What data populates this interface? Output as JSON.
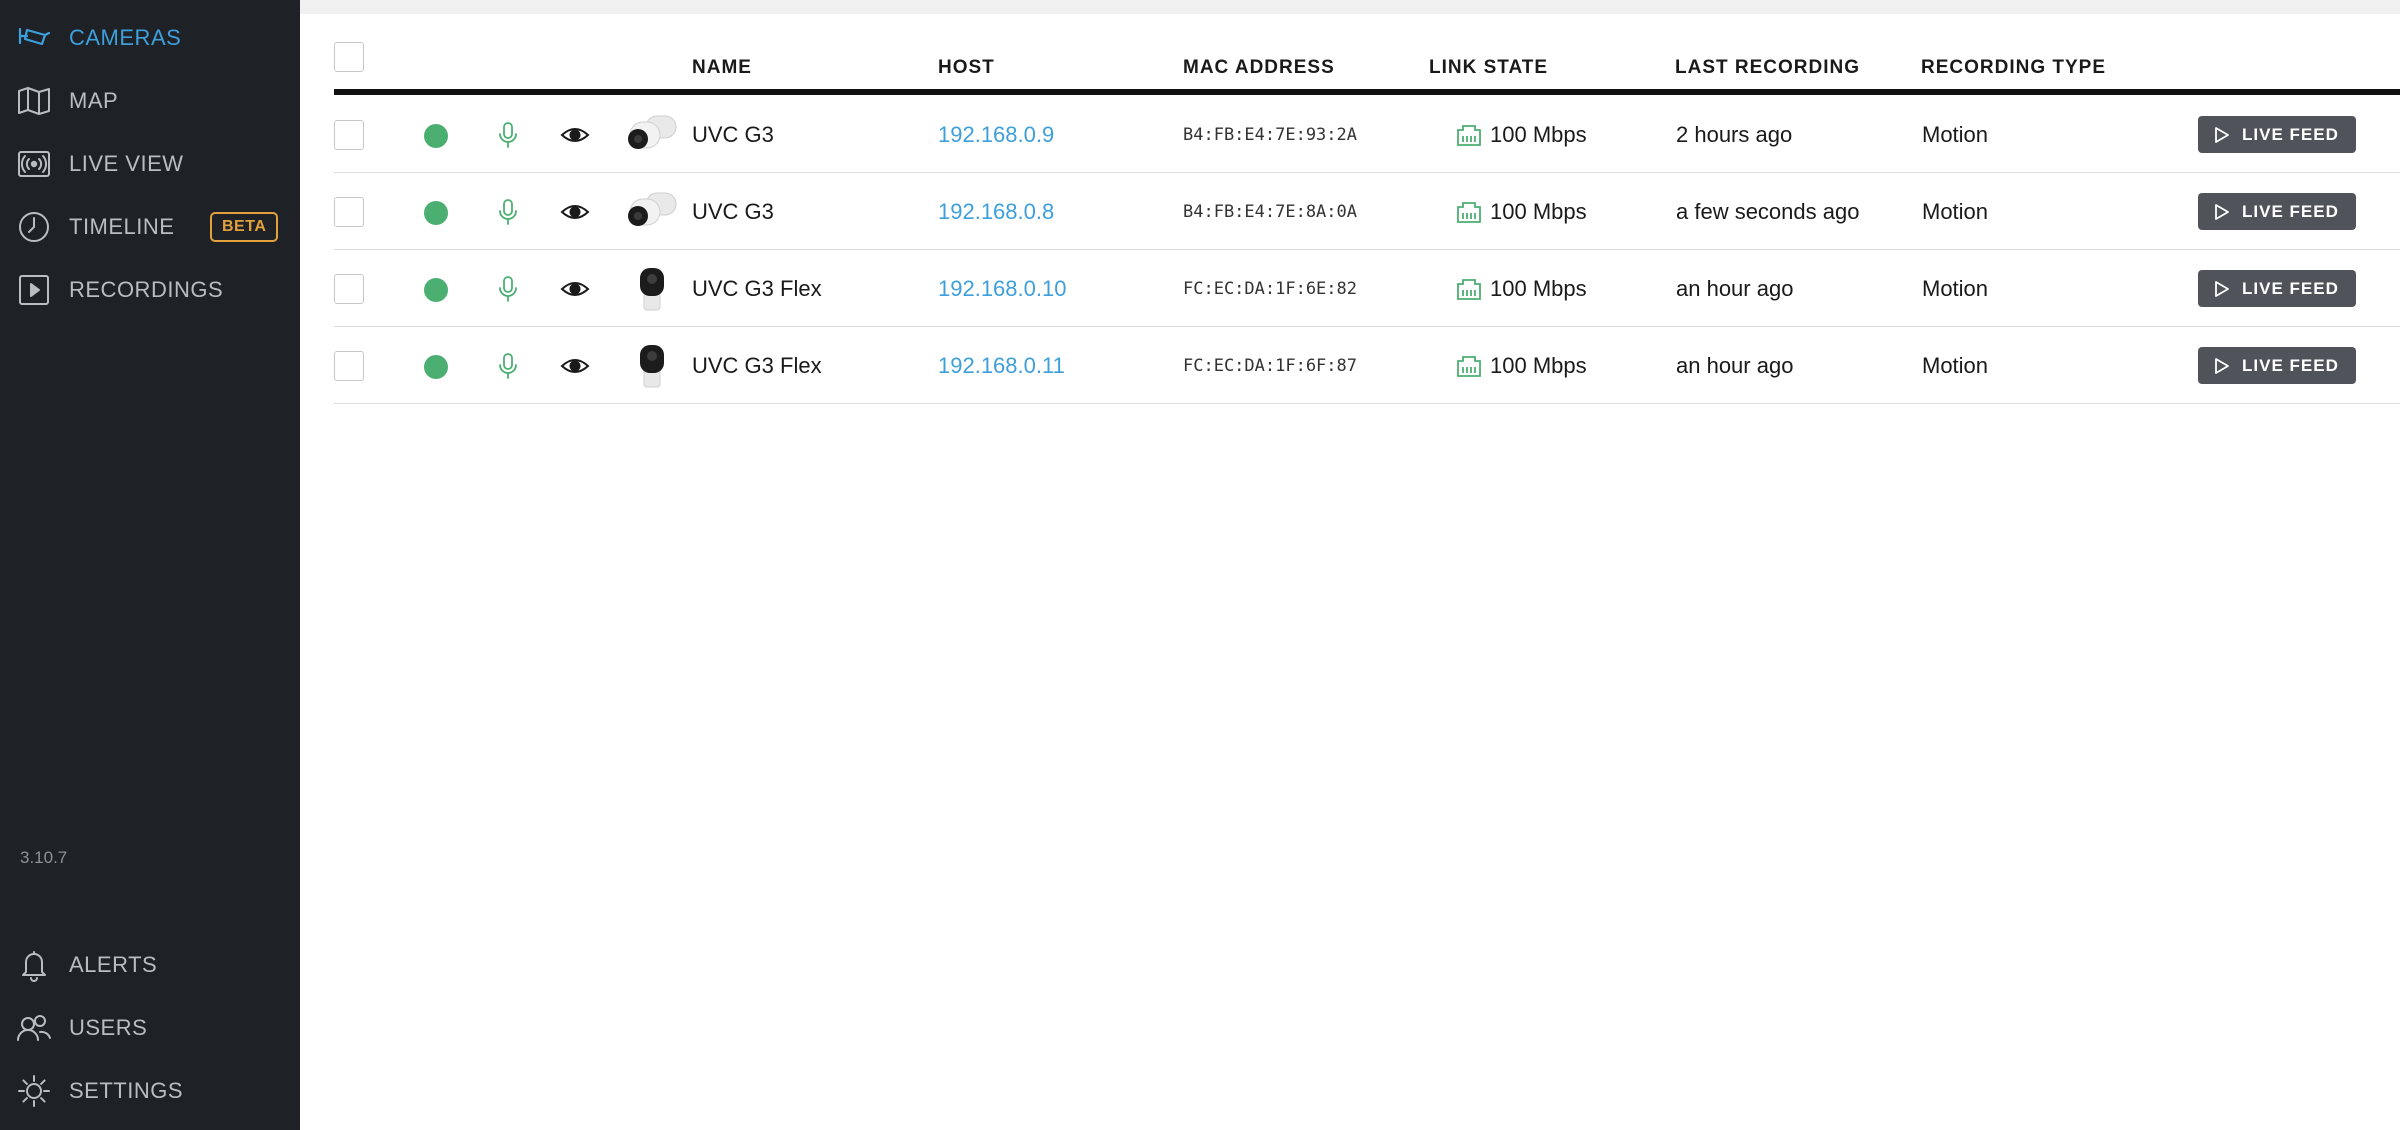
{
  "sidebar": {
    "nav": [
      {
        "label": "CAMERAS",
        "icon": "camera-icon",
        "active": true
      },
      {
        "label": "MAP",
        "icon": "map-icon"
      },
      {
        "label": "LIVE VIEW",
        "icon": "live-view-icon"
      },
      {
        "label": "TIMELINE",
        "icon": "clock-icon",
        "badge": "BETA"
      },
      {
        "label": "RECORDINGS",
        "icon": "play-box-icon"
      }
    ],
    "version": "3.10.7",
    "bottom_nav": [
      {
        "label": "ALERTS",
        "icon": "bell-icon"
      },
      {
        "label": "USERS",
        "icon": "users-icon"
      },
      {
        "label": "SETTINGS",
        "icon": "gear-icon"
      }
    ],
    "accent_color": "#3d9fdb",
    "badge_color": "#e3a13b"
  },
  "table": {
    "columns": {
      "name": "NAME",
      "host": "HOST",
      "mac": "MAC ADDRESS",
      "link": "LINK STATE",
      "last": "LAST RECORDING",
      "rtype": "RECORDING TYPE"
    },
    "live_feed_label": "LIVE FEED",
    "status_color": "#4caf72",
    "rows": [
      {
        "name": "UVC G3",
        "host": "192.168.0.9",
        "mac": "B4:FB:E4:7E:93:2A",
        "link": "100 Mbps",
        "last": "2 hours ago",
        "rtype": "Motion",
        "thumb": "bullet-camera"
      },
      {
        "name": "UVC G3",
        "host": "192.168.0.8",
        "mac": "B4:FB:E4:7E:8A:0A",
        "link": "100 Mbps",
        "last": "a few seconds ago",
        "rtype": "Motion",
        "thumb": "bullet-camera"
      },
      {
        "name": "UVC G3 Flex",
        "host": "192.168.0.10",
        "mac": "FC:EC:DA:1F:6E:82",
        "link": "100 Mbps",
        "last": "an hour ago",
        "rtype": "Motion",
        "thumb": "flex-camera"
      },
      {
        "name": "UVC G3 Flex",
        "host": "192.168.0.11",
        "mac": "FC:EC:DA:1F:6F:87",
        "link": "100 Mbps",
        "last": "an hour ago",
        "rtype": "Motion",
        "thumb": "flex-camera"
      }
    ]
  }
}
